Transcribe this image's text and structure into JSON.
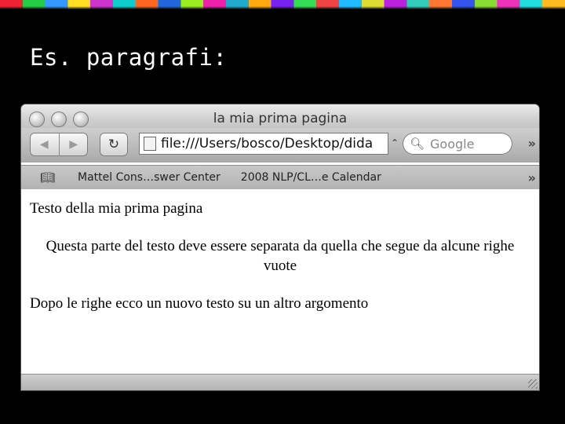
{
  "slide": {
    "title": "Es. paragrafi:"
  },
  "window": {
    "title": "la mia prima pagina",
    "address": "file:///Users/bosco/Desktop/dida",
    "search_placeholder": "Google",
    "bookmarks": [
      "Mattel Cons…swer Center",
      "2008 NLP/CL…e Calendar"
    ]
  },
  "page": {
    "paragraph1": "Testo della mia prima pagina",
    "paragraph2": "Questa parte del testo deve essere separata da quella che segue da alcune righe vuote",
    "paragraph3": "Dopo le righe ecco un nuovo testo su un altro argomento"
  }
}
